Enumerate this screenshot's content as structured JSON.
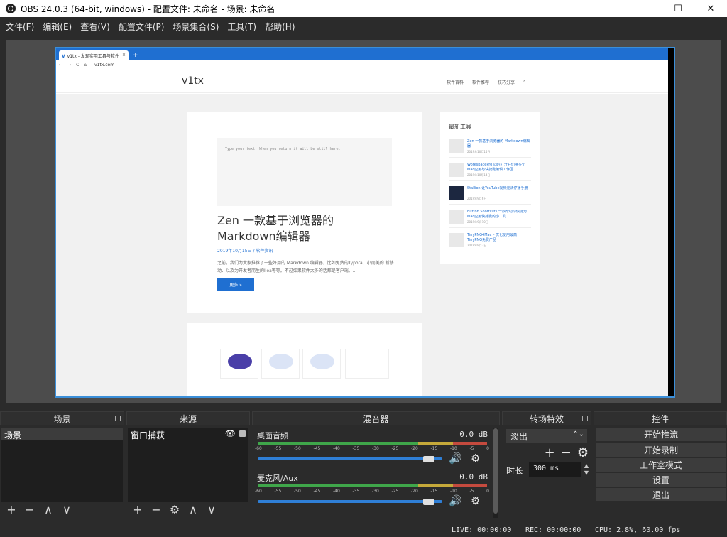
{
  "window": {
    "title": "OBS 24.0.3 (64-bit, windows) - 配置文件: 未命名 - 场景: 未命名",
    "minimize_glyph": "—",
    "maximize_glyph": "☐",
    "close_glyph": "✕"
  },
  "menu": [
    "文件(F)",
    "编辑(E)",
    "查看(V)",
    "配置文件(P)",
    "场景集合(S)",
    "工具(T)",
    "帮助(H)"
  ],
  "preview": {
    "browser": {
      "tab_title": "v1tx - 发现实用工具与软件",
      "tab_favicon": "V",
      "tab_close": "×",
      "new_tab": "+",
      "nav": [
        "←",
        "→",
        "C",
        "⌂"
      ],
      "url": "v1tx.com"
    },
    "site": {
      "logo": "v1tx",
      "nav": [
        "软件百科",
        "软件推荐",
        "技巧分享",
        "⌕"
      ],
      "post": {
        "thumb_text": "Type your text. When you return it will be still here.",
        "title": "Zen 一款基于浏览器的 Markdown编辑器",
        "meta": "2019年10月15日 / 软件资讯",
        "excerpt": "之前，我们为大家推荐了一些好用的 Markdown 编辑器，比如免费的Typora、小而美的 新移动、以及为开发者而生的Ilea等等。不过如果软件太多的话都是客户端。...",
        "more": "更多 »"
      },
      "widget": {
        "title": "最新工具",
        "items": [
          {
            "name": "Zen 一款基于浏览器的 Markdown编辑器",
            "date": "2019年10月15日",
            "dark": false
          },
          {
            "name": "WorkspacePro 同时打开并切换多个Mac应用与快捷键编辑工作区",
            "date": "2019年10月14日",
            "dark": false
          },
          {
            "name": "Stallion 让YouTube视频无法停播手册",
            "date": "2019年9月6日",
            "dark": true
          },
          {
            "name": "Button Shortcuts 一款帮助你快捷为Mac应用快捷键的小工具",
            "date": "2019年9月10日",
            "dark": false
          },
          {
            "name": "TinyPNG4Mac – 优化使用最高TinyPNG免费产品",
            "date": "2019年9月3日",
            "dark": false
          }
        ]
      }
    }
  },
  "docks": {
    "scenes": {
      "title": "场景",
      "items": [
        "场景"
      ],
      "toolbar": [
        "+",
        "−",
        "∧",
        "∨"
      ]
    },
    "sources": {
      "title": "来源",
      "items": [
        {
          "name": "窗口捕获",
          "visible_icon": "👁"
        }
      ],
      "toolbar": [
        "+",
        "−",
        "⚙",
        "∧",
        "∨"
      ]
    },
    "mixer": {
      "title": "混音器",
      "ticks": [
        "-60",
        "-55",
        "-50",
        "-45",
        "-40",
        "-35",
        "-30",
        "-25",
        "-20",
        "-15",
        "-10",
        "-5",
        "0"
      ],
      "channels": [
        {
          "name": "桌面音频",
          "db": "0.0 dB",
          "volume": 0.95
        },
        {
          "name": "麦克风/Aux",
          "db": "0.0 dB",
          "volume": 0.95
        }
      ],
      "speaker_icon": "🔊",
      "gear_icon": "⚙"
    },
    "transitions": {
      "title": "转场特效",
      "selected": "淡出",
      "spin_arrows": "⌃⌄",
      "tools": [
        "+",
        "−",
        "⚙"
      ],
      "duration_label": "时长",
      "duration_value": "300 ms",
      "spin_up": "▲",
      "spin_down": "▼"
    },
    "controls": {
      "title": "控件",
      "buttons": [
        "开始推流",
        "开始录制",
        "工作室模式",
        "设置",
        "退出"
      ]
    }
  },
  "status": {
    "live": "LIVE: 00:00:00",
    "rec": "REC: 00:00:00",
    "cpu": "CPU: 2.8%, 60.00 fps"
  },
  "colors": {
    "accent": "#2f7fd6",
    "meter_green": "#3fa64a",
    "meter_yellow": "#c5a93a",
    "meter_red": "#c44a3e"
  }
}
